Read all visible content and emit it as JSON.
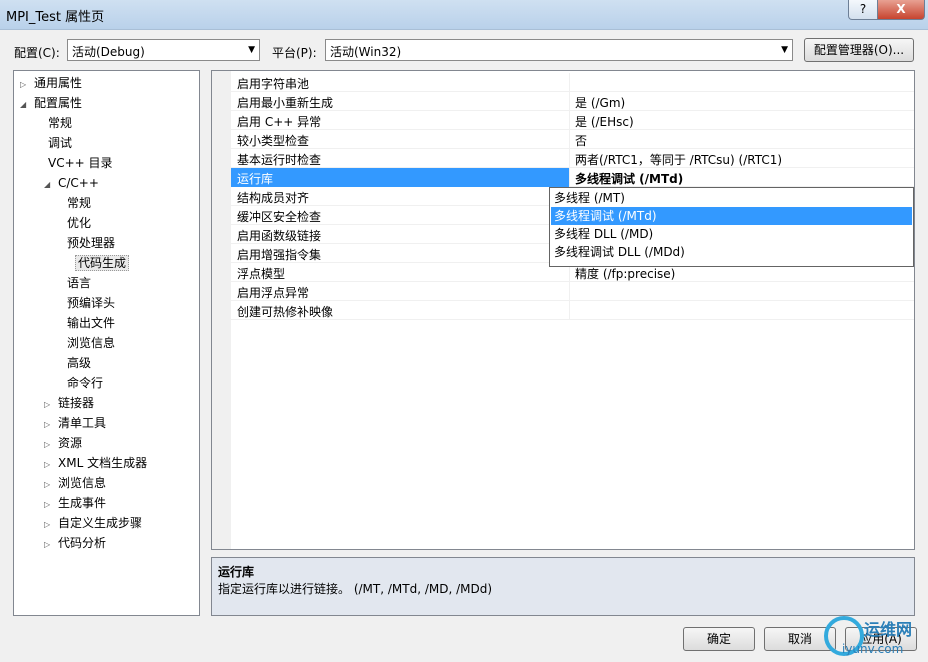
{
  "window": {
    "title": "MPI_Test 属性页",
    "help_label": "?",
    "close_label": "X"
  },
  "toolbar": {
    "config_label": "配置(C):",
    "config_value": "活动(Debug)",
    "platform_label": "平台(P):",
    "platform_value": "活动(Win32)",
    "config_manager_label": "配置管理器(O)..."
  },
  "tree": [
    {
      "label": "通用属性",
      "toggle": "▷"
    },
    {
      "label": "配置属性",
      "toggle": "◢"
    },
    {
      "label": "常规",
      "toggle": ""
    },
    {
      "label": "调试",
      "toggle": ""
    },
    {
      "label": "VC++ 目录",
      "toggle": ""
    },
    {
      "label": "C/C++",
      "toggle": "◢"
    },
    {
      "label": "常规",
      "toggle": ""
    },
    {
      "label": "优化",
      "toggle": ""
    },
    {
      "label": "预处理器",
      "toggle": ""
    },
    {
      "label": "代码生成",
      "toggle": ""
    },
    {
      "label": "语言",
      "toggle": ""
    },
    {
      "label": "预编译头",
      "toggle": ""
    },
    {
      "label": "输出文件",
      "toggle": ""
    },
    {
      "label": "浏览信息",
      "toggle": ""
    },
    {
      "label": "高级",
      "toggle": ""
    },
    {
      "label": "命令行",
      "toggle": ""
    },
    {
      "label": "链接器",
      "toggle": "▷"
    },
    {
      "label": "清单工具",
      "toggle": "▷"
    },
    {
      "label": "资源",
      "toggle": "▷"
    },
    {
      "label": "XML 文档生成器",
      "toggle": "▷"
    },
    {
      "label": "浏览信息",
      "toggle": "▷"
    },
    {
      "label": "生成事件",
      "toggle": "▷"
    },
    {
      "label": "自定义生成步骤",
      "toggle": "▷"
    },
    {
      "label": "代码分析",
      "toggle": "▷"
    }
  ],
  "properties": [
    {
      "name": "启用字符串池",
      "value": ""
    },
    {
      "name": "启用最小重新生成",
      "value": "是 (/Gm)"
    },
    {
      "name": "启用 C++ 异常",
      "value": "是 (/EHsc)"
    },
    {
      "name": "较小类型检查",
      "value": "否"
    },
    {
      "name": "基本运行时检查",
      "value": "两者(/RTC1，等同于 /RTCsu) (/RTC1)"
    },
    {
      "name": "运行库",
      "value": "多线程调试 (/MTd)"
    },
    {
      "name": "结构成员对齐",
      "value": ""
    },
    {
      "name": "缓冲区安全检查",
      "value": ""
    },
    {
      "name": "启用函数级链接",
      "value": ""
    },
    {
      "name": "启用增强指令集",
      "value": ""
    },
    {
      "name": "浮点模型",
      "value": "精度 (/fp:precise)"
    },
    {
      "name": "启用浮点异常",
      "value": ""
    },
    {
      "name": "创建可热修补映像",
      "value": ""
    }
  ],
  "dropdown_options": [
    "多线程 (/MT)",
    "多线程调试 (/MTd)",
    "多线程 DLL (/MD)",
    "多线程调试 DLL (/MDd)"
  ],
  "description": {
    "title": "运行库",
    "text": "指定运行库以进行链接。    (/MT, /MTd, /MD, /MDd)"
  },
  "buttons": {
    "ok": "确定",
    "cancel": "取消",
    "apply": "应用(A)"
  },
  "watermark": {
    "name": "运维网",
    "url": "iyunv.com"
  },
  "colors": {
    "selection": "#3399ff",
    "description_bg": "#e2e7ef"
  }
}
